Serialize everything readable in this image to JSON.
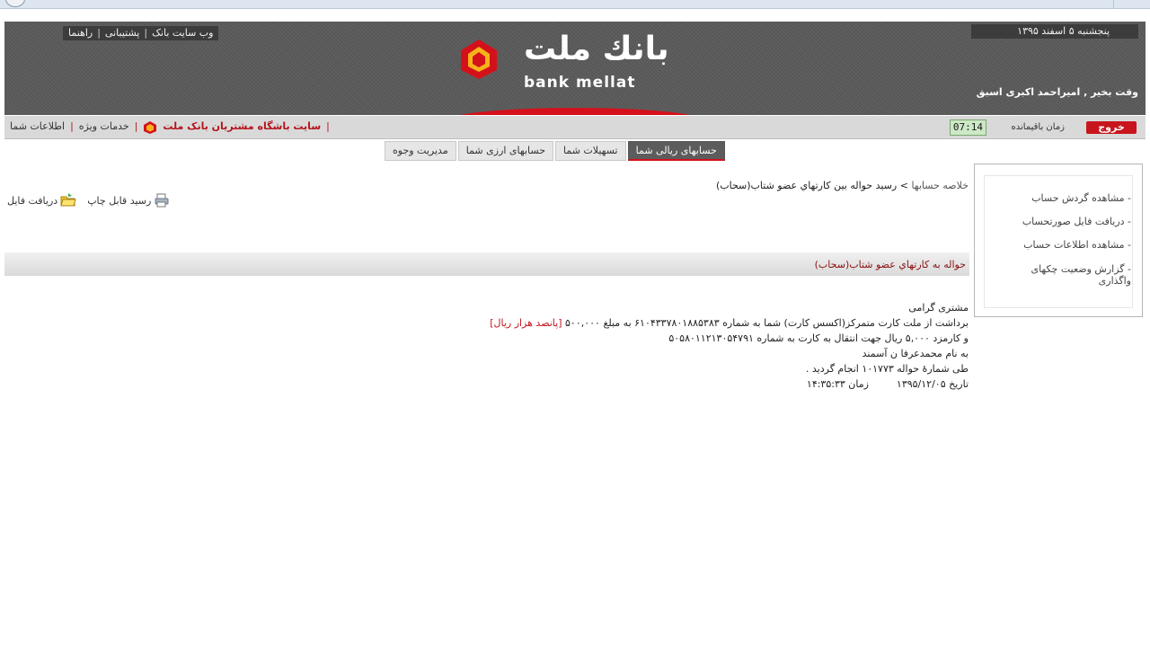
{
  "header": {
    "top_links": [
      "وب سایت بانک",
      "پشتیبانی",
      "راهنما"
    ],
    "date": "پنجشنبه ۵ اسفند ۱۳۹۵",
    "greeting": "وقت بخیر , امیراحمد اکبری اسبق",
    "logo_fa": "بانك ملت",
    "logo_en": "bank mellat"
  },
  "menubar": {
    "club": "سایت باشگاه مشتریان بانک ملت",
    "special_services": "خدمات ویژه",
    "your_info": "اطلاعات شما",
    "exit": "خروج",
    "timer_label": "زمان باقیمانده",
    "timer": "07:14"
  },
  "tabs": [
    {
      "label": "حسابهای ریالی شما",
      "active": true
    },
    {
      "label": "تسهیلات شما",
      "active": false
    },
    {
      "label": "حسابهای ارزی شما",
      "active": false
    },
    {
      "label": "مدیریت وجوه",
      "active": false
    }
  ],
  "sidebar": {
    "items": [
      "- مشاهده گردش حساب",
      "- دریافت فایل صورتحساب",
      "- مشاهده اطلاعات حساب",
      "- گزارش وضعیت چکهای واگذاری"
    ]
  },
  "breadcrumb": {
    "parent": "خلاصه حسابها",
    "separator": ">",
    "current": "رسید حواله بین کارتهاي عضو شتاب(سحاب)"
  },
  "actions": {
    "print": "رسید قابل چاپ",
    "download": "دریافت فایل"
  },
  "section_title": "حواله به کارتهاي عضو شتاب(سحاب)",
  "receipt": {
    "salutation": "مشتری گرامی",
    "line1_prefix": "برداشت از ملت کارت متمرکز(اکسس کارت) شما به شماره ۶۱۰۴۳۳۷۸۰۱۸۸۵۳۸۳ به مبلغ ۵۰۰,۰۰۰",
    "line1_amount_words": "[پانصد هزار ریال]",
    "line2": "و کارمزد ۵,۰۰۰ ریال جهت انتقال به کارت به شماره ۵۰۵۸۰۱۱۲۱۳۰۵۴۷۹۱",
    "line3": "به نام محمدعرفا ن آسمند",
    "line4": "طی شمارۀ حواله ۱۰۱۷۷۳ انجام گردید .",
    "date_label": "تاریخ",
    "date": "۱۳۹۵/۱۲/۰۵",
    "time_label": "زمان",
    "time": "۱۴:۳۵:۳۳"
  }
}
